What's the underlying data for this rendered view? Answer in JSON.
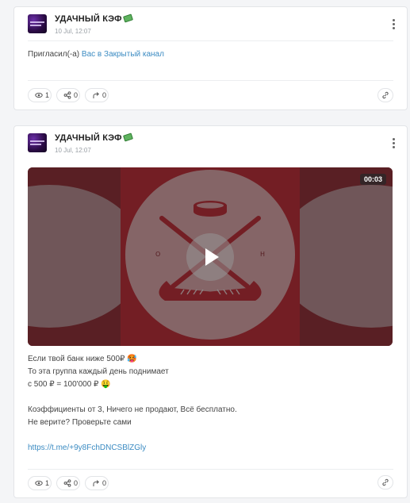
{
  "posts": [
    {
      "channel": "УДАЧНЫЙ КЭФ",
      "date": "10 Jul, 12:07",
      "text_prefix": "Пригласил(-а) ",
      "text_link": "Вас в Закрытый канал",
      "views": "1",
      "shares": "0",
      "forwards": "0"
    },
    {
      "channel": "УДАЧНЫЙ КЭФ",
      "date": "10 Jul, 12:07",
      "video_duration": "00:03",
      "video_letters": [
        "О",
        "Н"
      ],
      "lines": [
        "Если твой банк ниже 500₽ 🥵",
        "То эта группа каждый день поднимает",
        "с 500 ₽ = 100'000 ₽ 🤑",
        "Коэффициенты от 3, Ничего не продают, Всё бесплатно.",
        "Не верите? Проверьте сами"
      ],
      "url": "https://t.me/+9y8FchDNCSBlZGly",
      "views": "1",
      "shares": "0",
      "forwards": "0"
    }
  ],
  "icons": {
    "channel_emoji": "money-with-wings-icon",
    "menu": "kebab-menu-icon",
    "views": "eye-icon",
    "shares": "share-icon",
    "forwards": "forward-icon",
    "link": "link-icon",
    "play": "play-icon"
  },
  "colors": {
    "link": "#3b8bc2",
    "video_bg": "#7a2026"
  }
}
